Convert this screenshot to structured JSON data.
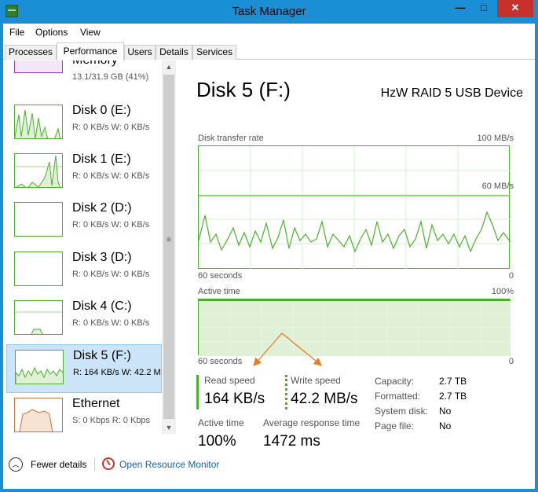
{
  "window": {
    "title": "Task Manager",
    "controls": {
      "minimize": "—",
      "maximize": "□",
      "close": "✕"
    }
  },
  "menu": {
    "file": "File",
    "options": "Options",
    "view": "View"
  },
  "tabs": [
    "Processes",
    "Performance",
    "Users",
    "Details",
    "Services"
  ],
  "sidebar": {
    "items": [
      {
        "name": "Memory",
        "detail": "13.1/31.9 GB (41%)"
      },
      {
        "name": "Disk 0 (E:)",
        "detail": "R: 0 KB/s W: 0 KB/s"
      },
      {
        "name": "Disk 1 (E:)",
        "detail": "R: 0 KB/s W: 0 KB/s"
      },
      {
        "name": "Disk 2 (D:)",
        "detail": "R: 0 KB/s W: 0 KB/s"
      },
      {
        "name": "Disk 3 (D:)",
        "detail": "R: 0 KB/s W: 0 KB/s"
      },
      {
        "name": "Disk 4 (C:)",
        "detail": "R: 0 KB/s W: 0 KB/s"
      },
      {
        "name": "Disk 5 (F:)",
        "detail": "R: 164 KB/s W: 42.2 M"
      },
      {
        "name": "Ethernet",
        "detail": "S: 0 Kbps R: 0 Kbps"
      }
    ],
    "scroll": {
      "up": "▲",
      "down": "▼",
      "grip": "≡"
    }
  },
  "detail": {
    "title": "Disk 5 (F:)",
    "device": "HzW RAID 5 USB Device",
    "transfer_graph": {
      "label": "Disk transfer rate",
      "max": "100 MB/s",
      "mid": "60 MB/s",
      "time": "60 seconds",
      "min": "0"
    },
    "active_graph": {
      "label": "Active time",
      "max": "100%",
      "time": "60 seconds",
      "min": "0"
    },
    "read_speed": {
      "label": "Read speed",
      "value": "164 KB/s"
    },
    "write_speed": {
      "label": "Write speed",
      "value": "42.2 MB/s"
    },
    "active_time": {
      "label": "Active time",
      "value": "100%"
    },
    "response_time": {
      "label": "Average response time",
      "value": "1472 ms"
    },
    "properties": {
      "capacity": {
        "label": "Capacity:",
        "value": "2.7 TB"
      },
      "formatted": {
        "label": "Formatted:",
        "value": "2.7 TB"
      },
      "system_disk": {
        "label": "System disk:",
        "value": "No"
      },
      "page_file": {
        "label": "Page file:",
        "value": "No"
      }
    }
  },
  "footer": {
    "fewer_details": "Fewer details",
    "resource_monitor": "Open Resource Monitor",
    "fewer_icon": "︿"
  },
  "colors": {
    "disk": "#4caf2c",
    "memory": "#8e44ad",
    "ethernet": "#c8733a",
    "annotation": "#e67e22",
    "link": "#1a5fa8"
  }
}
